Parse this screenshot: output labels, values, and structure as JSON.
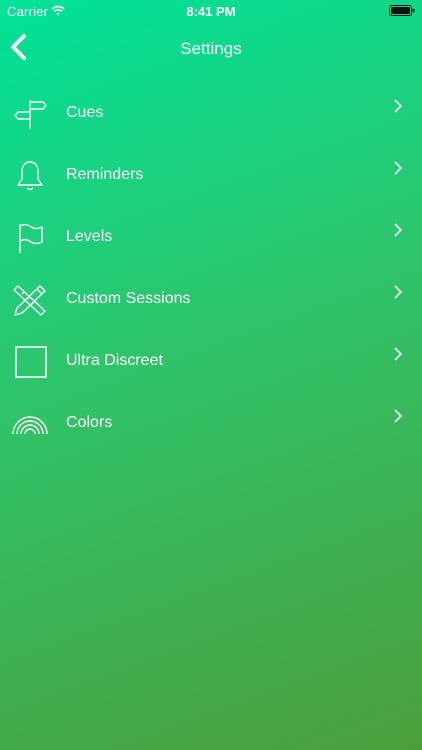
{
  "status_bar": {
    "carrier": "Carrier",
    "time": "8:41 PM",
    "icons": [
      "wifi-icon",
      "battery-icon"
    ]
  },
  "nav": {
    "title": "Settings",
    "back_icon": "chevron-left-icon"
  },
  "colors": {
    "gradient_top": "#00e29a",
    "gradient_bottom": "#4c9e3c",
    "text": "#ffffff"
  },
  "menu": {
    "items": [
      {
        "label": "Cues",
        "icon": "signpost-icon"
      },
      {
        "label": "Reminders",
        "icon": "bell-icon"
      },
      {
        "label": "Levels",
        "icon": "flag-icon"
      },
      {
        "label": "Custom Sessions",
        "icon": "pencil-ruler-icon"
      },
      {
        "label": "Ultra Discreet",
        "icon": "square-icon"
      },
      {
        "label": "Colors",
        "icon": "rainbow-icon"
      }
    ]
  }
}
